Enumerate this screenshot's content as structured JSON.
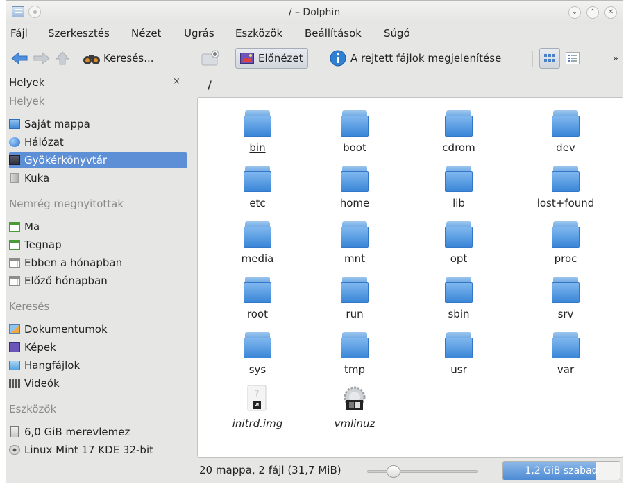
{
  "window": {
    "title": "/ – Dolphin"
  },
  "menu": [
    "Fájl",
    "Szerkesztés",
    "Nézet",
    "Ugrás",
    "Eszközök",
    "Beállítások",
    "Súgó"
  ],
  "toolbar": {
    "search_label": "Keresés...",
    "preview_label": "Előnézet",
    "hidden_files_label": "A rejtett fájlok megjelenítése",
    "more": "»"
  },
  "sidebar": {
    "panel_title": "Helyek",
    "close": "×",
    "groups": [
      {
        "header": "Helyek",
        "items": [
          {
            "label": "Saját mappa",
            "icon": "home-icon"
          },
          {
            "label": "Hálózat",
            "icon": "network-icon"
          },
          {
            "label": "Gyökérkönyvtár",
            "icon": "root-folder-icon",
            "selected": true
          },
          {
            "label": "Kuka",
            "icon": "trash-icon"
          }
        ]
      },
      {
        "header": "Nemrég megnyitottak",
        "items": [
          {
            "label": "Ma",
            "icon": "calendar-today-icon"
          },
          {
            "label": "Tegnap",
            "icon": "calendar-yesterday-icon"
          },
          {
            "label": "Ebben a hónapban",
            "icon": "calendar-month-icon"
          },
          {
            "label": "Előző hónapban",
            "icon": "calendar-month-icon"
          }
        ]
      },
      {
        "header": "Keresés",
        "items": [
          {
            "label": "Dokumentumok",
            "icon": "documents-icon"
          },
          {
            "label": "Képek",
            "icon": "images-icon"
          },
          {
            "label": "Hangfájlok",
            "icon": "audio-icon"
          },
          {
            "label": "Videók",
            "icon": "video-icon"
          }
        ]
      },
      {
        "header": "Eszközök",
        "items": [
          {
            "label": "6,0 GiB merevlemez",
            "icon": "harddisk-icon"
          },
          {
            "label": "Linux Mint 17 KDE 32-bit",
            "icon": "optical-disc-icon"
          }
        ]
      }
    ]
  },
  "location": {
    "path": "/"
  },
  "files": [
    {
      "name": "bin",
      "type": "folder"
    },
    {
      "name": "boot",
      "type": "folder"
    },
    {
      "name": "cdrom",
      "type": "folder"
    },
    {
      "name": "dev",
      "type": "folder"
    },
    {
      "name": "etc",
      "type": "folder"
    },
    {
      "name": "home",
      "type": "folder"
    },
    {
      "name": "lib",
      "type": "folder"
    },
    {
      "name": "lost+found",
      "type": "folder"
    },
    {
      "name": "media",
      "type": "folder"
    },
    {
      "name": "mnt",
      "type": "folder"
    },
    {
      "name": "opt",
      "type": "folder"
    },
    {
      "name": "proc",
      "type": "folder"
    },
    {
      "name": "root",
      "type": "folder"
    },
    {
      "name": "run",
      "type": "folder"
    },
    {
      "name": "sbin",
      "type": "folder"
    },
    {
      "name": "srv",
      "type": "folder"
    },
    {
      "name": "sys",
      "type": "folder"
    },
    {
      "name": "tmp",
      "type": "folder"
    },
    {
      "name": "usr",
      "type": "folder"
    },
    {
      "name": "var",
      "type": "folder"
    },
    {
      "name": "initrd.img",
      "type": "link-file"
    },
    {
      "name": "vmlinuz",
      "type": "link-executable"
    }
  ],
  "status": {
    "summary": "20 mappa, 2 fájl (31,7 MiB)",
    "free_space": "1,2 GiB szabad",
    "used_fraction": 0.8,
    "zoom_fraction": 0.2
  }
}
